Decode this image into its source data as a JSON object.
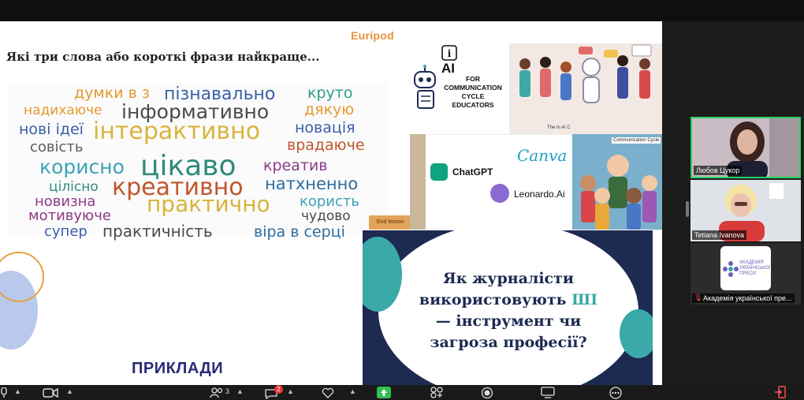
{
  "slide_left": {
    "top_cut_text": "",
    "brand": "Euripod",
    "question": "Які три слова або короткі фрази найкраще...",
    "word_cloud": [
      {
        "text": "думки в з",
        "color": "#e39a2d"
      },
      {
        "text": "пізнавально",
        "color": "#3a5fa8"
      },
      {
        "text": "круто",
        "color": "#2f9a8f"
      },
      {
        "text": "надихаюче",
        "color": "#e39a2d"
      },
      {
        "text": "інформативно",
        "color": "#4a4a4a"
      },
      {
        "text": "дякую",
        "color": "#e39a2d"
      },
      {
        "text": "нові ідеї",
        "color": "#3a5fa8"
      },
      {
        "text": "інтерактивно",
        "color": "#d9b43a"
      },
      {
        "text": "новація",
        "color": "#3a5fa8"
      },
      {
        "text": "совість",
        "color": "#5a5a5a"
      },
      {
        "text": "врадаюче",
        "color": "#c0562e"
      },
      {
        "text": "корисно",
        "color": "#3aa3b6"
      },
      {
        "text": "цікаво",
        "color": "#2f8a7c"
      },
      {
        "text": "креатив",
        "color": "#8e3a86"
      },
      {
        "text": "цілісно",
        "color": "#2f8a7c"
      },
      {
        "text": "креативно",
        "color": "#c0562e"
      },
      {
        "text": "натхненно",
        "color": "#2f6d9e"
      },
      {
        "text": "новизна",
        "color": "#8e3a86"
      },
      {
        "text": "практично",
        "color": "#d9b43a"
      },
      {
        "text": "користь",
        "color": "#3aa3b6"
      },
      {
        "text": "мотивуюче",
        "color": "#8e3a86"
      },
      {
        "text": "чудово",
        "color": "#4a4a4a"
      },
      {
        "text": "супер",
        "color": "#3a5fa8"
      },
      {
        "text": "практичність",
        "color": "#4a4a4a"
      },
      {
        "text": "віра в серці",
        "color": "#2f6d9e"
      }
    ],
    "end_lesson": "End lesson",
    "section_title": "ПРИКЛАДИ"
  },
  "collage": {
    "ai_title": "AI",
    "ai_subtitle": "FOR COMMUNICATION CYCLE EDUCATORS",
    "people_caption": "The in AI C",
    "canva": "Canva",
    "chatgpt": "ChatGPT",
    "leonardo": "Leonardo.Ai",
    "cartoon_caption": "Communication Cycle"
  },
  "question_slide": {
    "line1": "Як журналісти",
    "line2_pre": "використовують ",
    "line2_hl": "ШІ",
    "line3": "— інструмент чи",
    "line4": "загроза професії?"
  },
  "participants": [
    {
      "name": "Любов Цукор"
    },
    {
      "name": "Tetiana Ivanova"
    },
    {
      "name": "Академія української пре..."
    }
  ],
  "org_logo_text": "АКАДЕМІЯ УКРАЇНСЬКОЇ ПРЕСИ",
  "toolbar": {
    "participants_count": "3",
    "chat_badge": "2"
  },
  "colors": {
    "question_navy": "#1d2a52",
    "teal": "#3aa9a8",
    "active_speaker": "#2ad15f",
    "share_green": "#2fc152"
  }
}
